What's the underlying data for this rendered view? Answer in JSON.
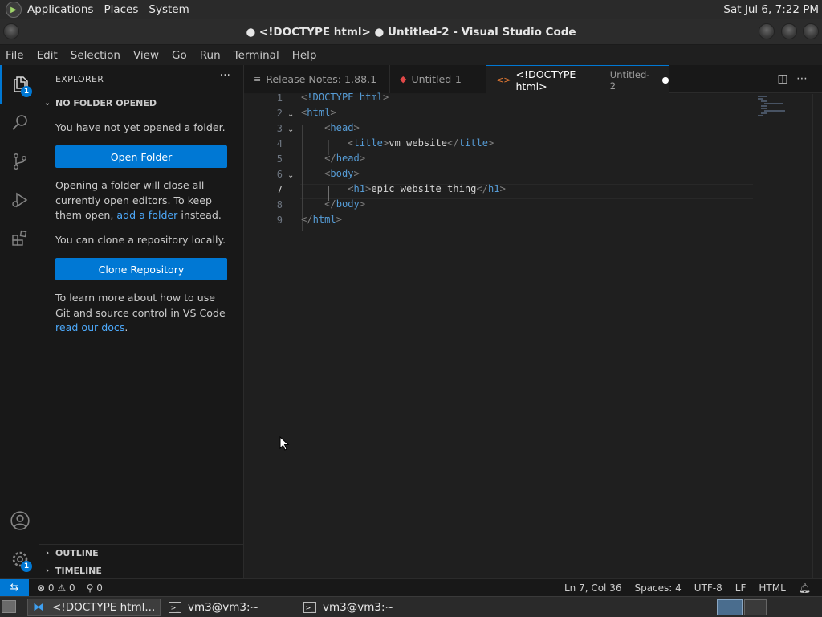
{
  "gnome_panel": {
    "menus": [
      "Applications",
      "Places",
      "System"
    ],
    "clock": "Sat Jul  6,  7:22 PM"
  },
  "window": {
    "title": "● <!DOCTYPE html> ● Untitled-2 - Visual Studio Code"
  },
  "menubar": [
    "File",
    "Edit",
    "Selection",
    "View",
    "Go",
    "Run",
    "Terminal",
    "Help"
  ],
  "activity_bar": {
    "explorer_badge": "1",
    "manage_badge": "1",
    "icons": [
      "files-icon",
      "search-icon",
      "source-control-icon",
      "run-debug-icon",
      "extensions-icon",
      "accounts-icon",
      "gear-icon"
    ]
  },
  "sidebar": {
    "title": "EXPLORER",
    "more": "···",
    "section": "NO FOLDER OPENED",
    "msg1": "You have not yet opened a folder.",
    "open_folder": "Open Folder",
    "msg2_pre": "Opening a folder will close all currently open editors. To keep them open, ",
    "msg2_link": "add a folder",
    "msg2_post": " instead.",
    "msg3": "You can clone a repository locally.",
    "clone": "Clone Repository",
    "msg4_pre": "To learn more about how to use Git and source control in VS Code ",
    "msg4_link": "read our docs",
    "msg4_post": ".",
    "outline": "OUTLINE",
    "timeline": "TIMELINE"
  },
  "tabs": [
    {
      "label": "Release Notes: 1.88.1",
      "icon": "file-icon",
      "desc": ""
    },
    {
      "label": "Untitled-1",
      "icon": "red-file-icon",
      "desc": ""
    },
    {
      "label": "<!DOCTYPE html>",
      "icon": "html-icon",
      "desc": "Untitled-2"
    }
  ],
  "editor": {
    "lines": [
      "1",
      "2",
      "3",
      "4",
      "5",
      "6",
      "7",
      "8",
      "9"
    ],
    "current_line": 7
  },
  "statusbar": {
    "errors": "0",
    "warnings": "0",
    "ports": "0",
    "position": "Ln 7, Col 36",
    "spaces": "Spaces: 4",
    "encoding": "UTF-8",
    "eol": "LF",
    "language": "HTML"
  },
  "taskbar": {
    "items": [
      "<!DOCTYPE html...",
      "vm3@vm3:~",
      "vm3@vm3:~"
    ]
  },
  "colors": {
    "accent": "#0078d4",
    "tag_name": "#569cd6",
    "tag_bracket": "#808080",
    "text": "#d4d4d4"
  }
}
